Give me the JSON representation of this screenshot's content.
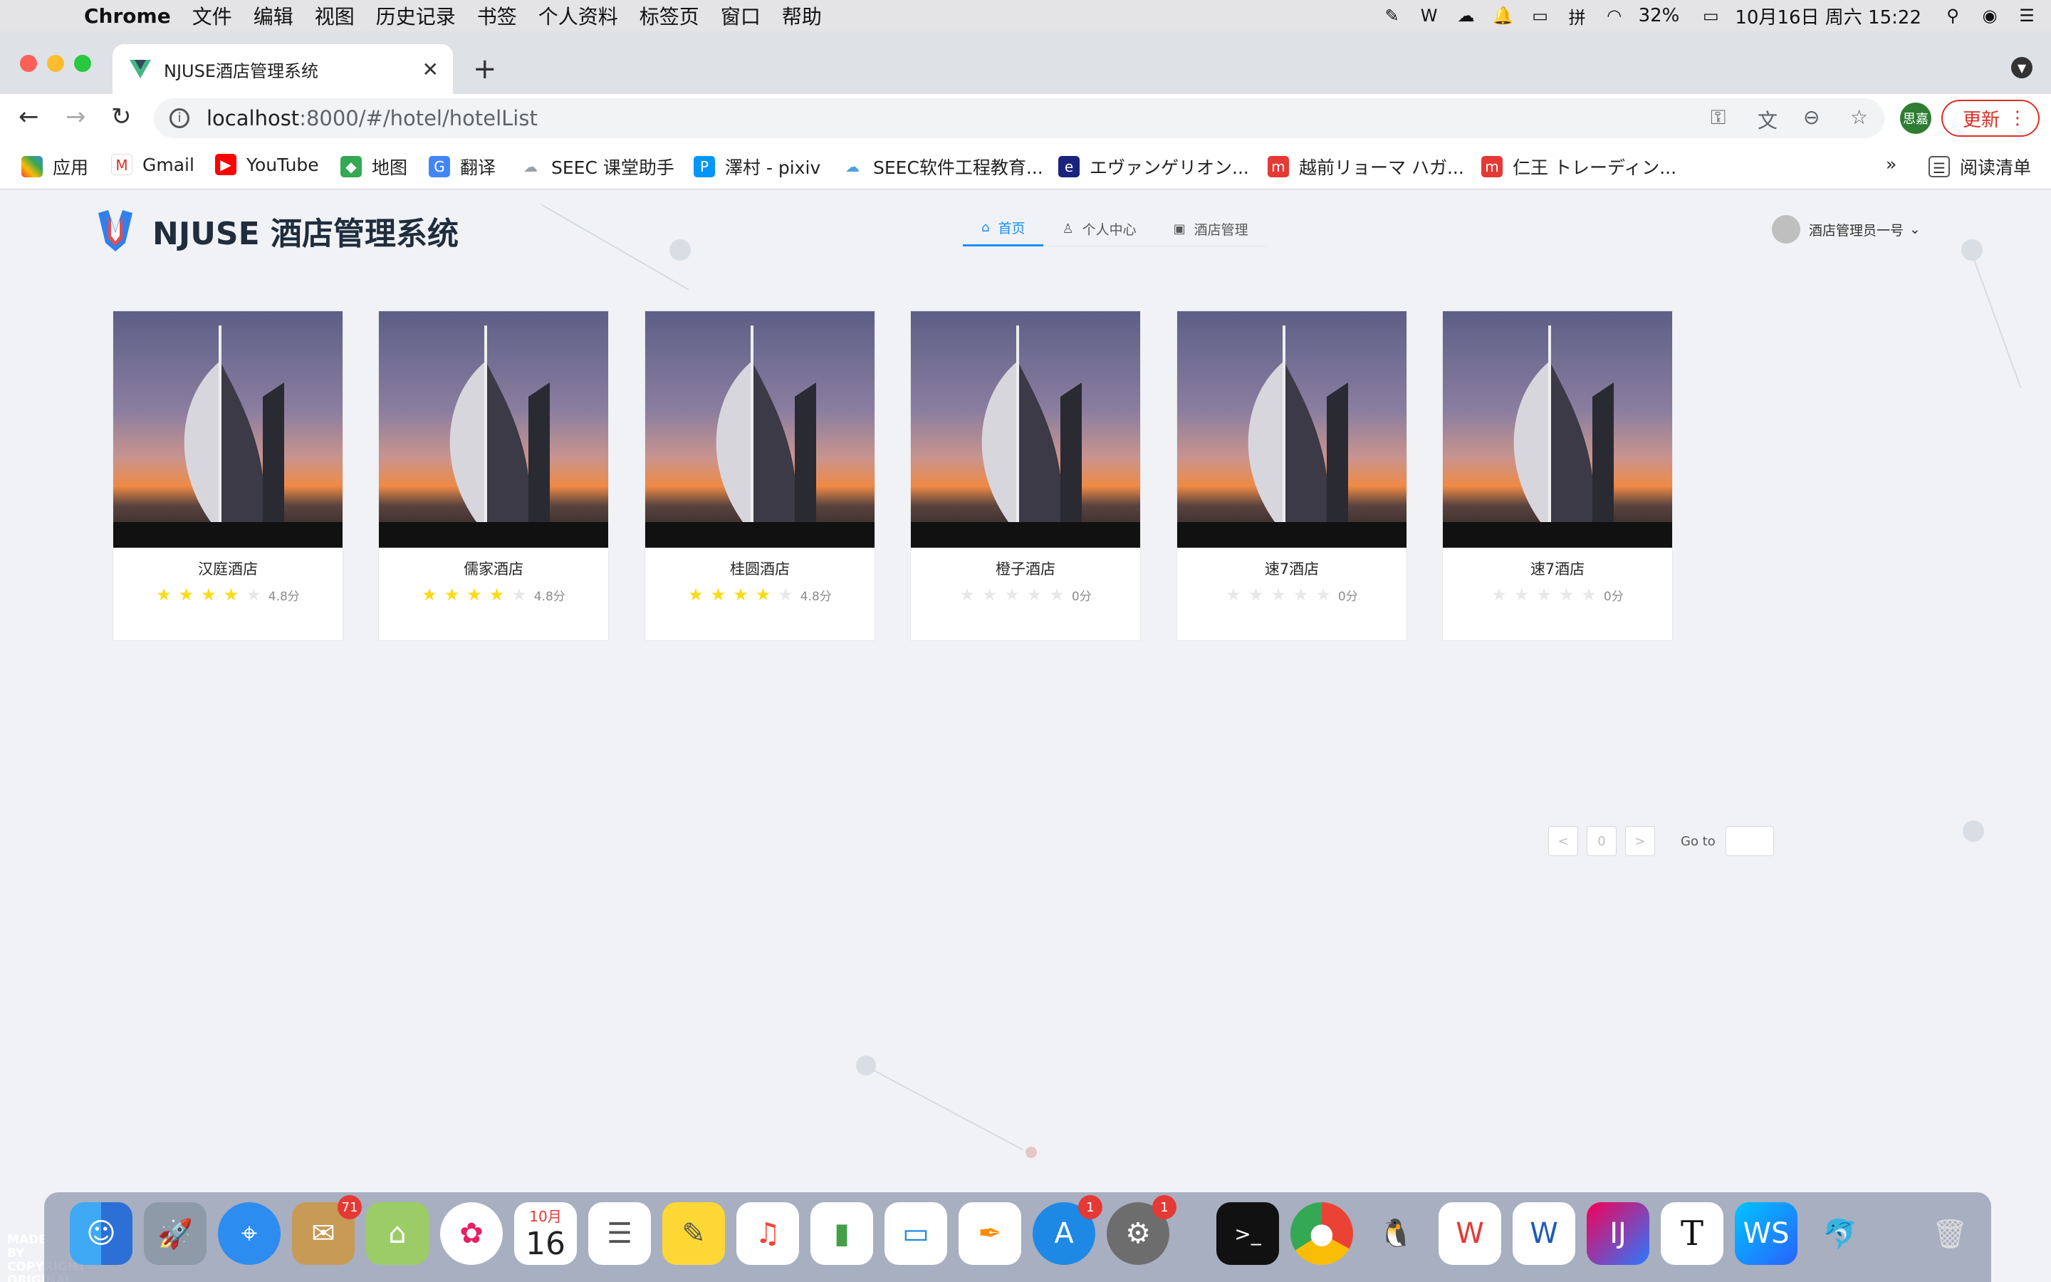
{
  "menubar": {
    "app": "Chrome",
    "items": [
      "文件",
      "编辑",
      "视图",
      "历史记录",
      "书签",
      "个人资料",
      "标签页",
      "窗口",
      "帮助"
    ],
    "battery": "32%",
    "datetime": "10月16日 周六  15:22"
  },
  "browser": {
    "tab_title": "NJUSE酒店管理系统",
    "url_host": "localhost",
    "url_rest": ":8000/#/hotel/hotelList",
    "profile": "思嘉",
    "update_label": "更新",
    "bookmarks": [
      {
        "label": "应用",
        "icon": "apps-icon",
        "color": "#ea4335"
      },
      {
        "label": "Gmail",
        "icon": "gmail-icon",
        "color": "#d93025"
      },
      {
        "label": "YouTube",
        "icon": "youtube-icon",
        "color": "#ff0000"
      },
      {
        "label": "地图",
        "icon": "maps-icon",
        "color": "#34a853"
      },
      {
        "label": "翻译",
        "icon": "translate-icon",
        "color": "#4285f4"
      },
      {
        "label": "SEEC 课堂助手",
        "icon": "cloud-icon",
        "color": "#9aa0a6"
      },
      {
        "label": "澤村 - pixiv",
        "icon": "pixiv-icon",
        "color": "#0096fa"
      },
      {
        "label": "SEEC软件工程教育...",
        "icon": "cloud-icon",
        "color": "#4aa3df"
      },
      {
        "label": "エヴァンゲリオン...",
        "icon": "eva-icon",
        "color": "#1a237e"
      },
      {
        "label": "越前リョーマ ハガ...",
        "icon": "mercari-icon",
        "color": "#e53935"
      },
      {
        "label": "仁王 トレーディン...",
        "icon": "mercari-icon",
        "color": "#e53935"
      }
    ],
    "reading_list": "阅读清单",
    "more_label": "»"
  },
  "app": {
    "brand": "NJUSE 酒店管理系统",
    "nav": [
      {
        "label": "首页",
        "icon": "home-icon",
        "active": true
      },
      {
        "label": "个人中心",
        "icon": "user-icon",
        "active": false
      },
      {
        "label": "酒店管理",
        "icon": "hotel-icon",
        "active": false
      }
    ],
    "user_name": "酒店管理员一号",
    "hotels": [
      {
        "name": "汉庭酒店",
        "stars": 4,
        "score": "4.8分"
      },
      {
        "name": "儒家酒店",
        "stars": 4,
        "score": "4.8分"
      },
      {
        "name": "桂圆酒店",
        "stars": 4,
        "score": "4.8分"
      },
      {
        "name": "橙子酒店",
        "stars": 0,
        "score": "0分"
      },
      {
        "name": "速7酒店",
        "stars": 0,
        "score": "0分"
      },
      {
        "name": "速7酒店",
        "stars": 0,
        "score": "0分"
      }
    ],
    "pagination": {
      "prev": "<",
      "page": "0",
      "next": ">",
      "goto_label": "Go to"
    }
  },
  "dock": {
    "made_by": "MADE BY COPYRIGHT ORIGINAL",
    "badges": {
      "mail": "71",
      "appstore": "1",
      "settings": "1"
    },
    "calendar_month": "10月",
    "calendar_day": "16"
  }
}
